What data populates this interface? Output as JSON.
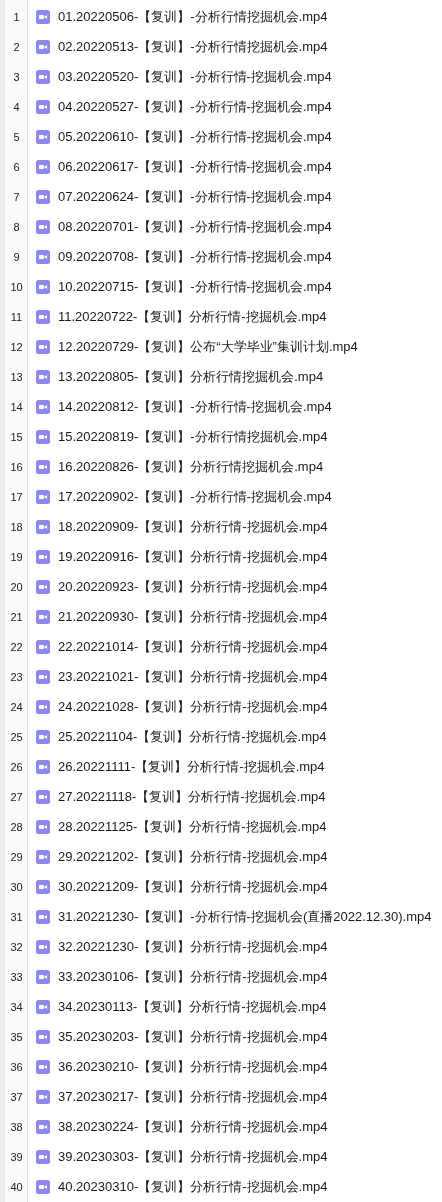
{
  "files": [
    {
      "line": "1",
      "name": "01.20220506-【复训】-分析行情挖掘机会.mp4"
    },
    {
      "line": "2",
      "name": "02.20220513-【复训】-分析行情挖掘机会.mp4"
    },
    {
      "line": "3",
      "name": "03.20220520-【复训】-分析行情-挖掘机会.mp4"
    },
    {
      "line": "4",
      "name": "04.20220527-【复训】-分析行情-挖掘机会.mp4"
    },
    {
      "line": "5",
      "name": "05.20220610-【复训】-分析行情-挖掘机会.mp4"
    },
    {
      "line": "6",
      "name": "06.20220617-【复训】-分析行情-挖掘机会.mp4"
    },
    {
      "line": "7",
      "name": "07.20220624-【复训】-分析行情-挖掘机会.mp4"
    },
    {
      "line": "8",
      "name": "08.20220701-【复训】-分析行情-挖掘机会.mp4"
    },
    {
      "line": "9",
      "name": "09.20220708-【复训】-分析行情-挖掘机会.mp4"
    },
    {
      "line": "10",
      "name": "10.20220715-【复训】-分析行情-挖掘机会.mp4"
    },
    {
      "line": "11",
      "name": "11.20220722-【复训】分析行情-挖掘机会.mp4"
    },
    {
      "line": "12",
      "name": "12.20220729-【复训】公布“大学毕业”集训计划.mp4"
    },
    {
      "line": "13",
      "name": "13.20220805-【复训】分析行情挖掘机会.mp4"
    },
    {
      "line": "14",
      "name": "14.20220812-【复训】-分析行情-挖掘机会.mp4"
    },
    {
      "line": "15",
      "name": "15.20220819-【复训】-分析行情挖掘机会.mp4"
    },
    {
      "line": "16",
      "name": "16.20220826-【复训】分析行情挖掘机会.mp4"
    },
    {
      "line": "17",
      "name": "17.20220902-【复训】-分析行情-挖掘机会.mp4"
    },
    {
      "line": "18",
      "name": "18.20220909-【复训】分析行情-挖掘机会.mp4"
    },
    {
      "line": "19",
      "name": "19.20220916-【复训】分析行情-挖掘机会.mp4"
    },
    {
      "line": "20",
      "name": "20.20220923-【复训】分析行情-挖掘机会.mp4"
    },
    {
      "line": "21",
      "name": "21.20220930-【复训】分析行情-挖掘机会.mp4"
    },
    {
      "line": "22",
      "name": "22.20221014-【复训】分析行情-挖掘机会.mp4"
    },
    {
      "line": "23",
      "name": "23.20221021-【复训】分析行情-挖掘机会.mp4"
    },
    {
      "line": "24",
      "name": "24.20221028-【复训】分析行情-挖掘机会.mp4"
    },
    {
      "line": "25",
      "name": "25.20221104-【复训】分析行情-挖掘机会.mp4"
    },
    {
      "line": "26",
      "name": "26.20221111-【复训】分析行情-挖掘机会.mp4"
    },
    {
      "line": "27",
      "name": "27.20221118-【复训】分析行情-挖掘机会.mp4"
    },
    {
      "line": "28",
      "name": "28.20221125-【复训】分析行情-挖掘机会.mp4"
    },
    {
      "line": "29",
      "name": "29.20221202-【复训】分析行情-挖掘机会.mp4"
    },
    {
      "line": "30",
      "name": "30.20221209-【复训】分析行情-挖掘机会.mp4"
    },
    {
      "line": "31",
      "name": "31.20221230-【复训】-分析行情-挖掘机会(直播2022.12.30).mp4"
    },
    {
      "line": "32",
      "name": "32.20221230-【复训】分析行情-挖掘机会.mp4"
    },
    {
      "line": "33",
      "name": "33.20230106-【复训】分析行情-挖掘机会.mp4"
    },
    {
      "line": "34",
      "name": "34.20230113-【复训】分析行情-挖掘机会.mp4"
    },
    {
      "line": "35",
      "name": "35.20230203-【复训】分析行情-挖掘机会.mp4"
    },
    {
      "line": "36",
      "name": "36.20230210-【复训】分析行情-挖掘机会.mp4"
    },
    {
      "line": "37",
      "name": "37.20230217-【复训】分析行情-挖掘机会.mp4"
    },
    {
      "line": "38",
      "name": "38.20230224-【复训】分析行情-挖掘机会.mp4"
    },
    {
      "line": "39",
      "name": "39.20230303-【复训】分析行情-挖掘机会.mp4"
    },
    {
      "line": "40",
      "name": "40.20230310-【复训】分析行情-挖掘机会.mp4"
    }
  ]
}
